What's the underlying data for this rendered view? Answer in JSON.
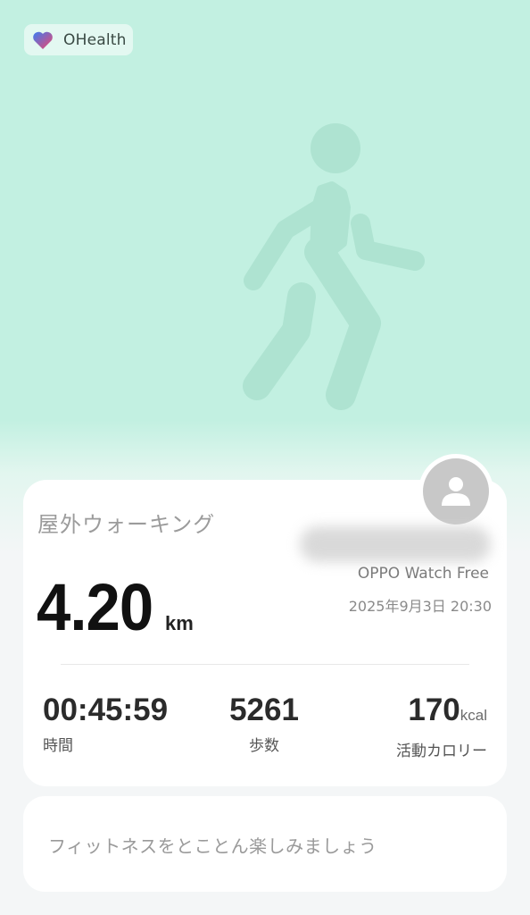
{
  "app": {
    "name": "OHealth",
    "logo_icon": "heart-icon"
  },
  "hero": {
    "illustration": "walking-person-icon",
    "background_color": "#c2f0e1"
  },
  "activity": {
    "title": "屋外ウォーキング",
    "device": "OPPO Watch Free",
    "datetime": "2025年9月3日 20:30",
    "distance_value": "4.20",
    "distance_unit": "km",
    "avatar_icon": "user-avatar-icon"
  },
  "stats": {
    "duration": {
      "value": "00:45:59",
      "label": "時間"
    },
    "steps": {
      "value": "5261",
      "label": "歩数"
    },
    "calories": {
      "value": "170",
      "unit": "kcal",
      "label": "活動カロリー"
    }
  },
  "promo": {
    "text": "フィットネスをとことん楽しみましょう"
  }
}
